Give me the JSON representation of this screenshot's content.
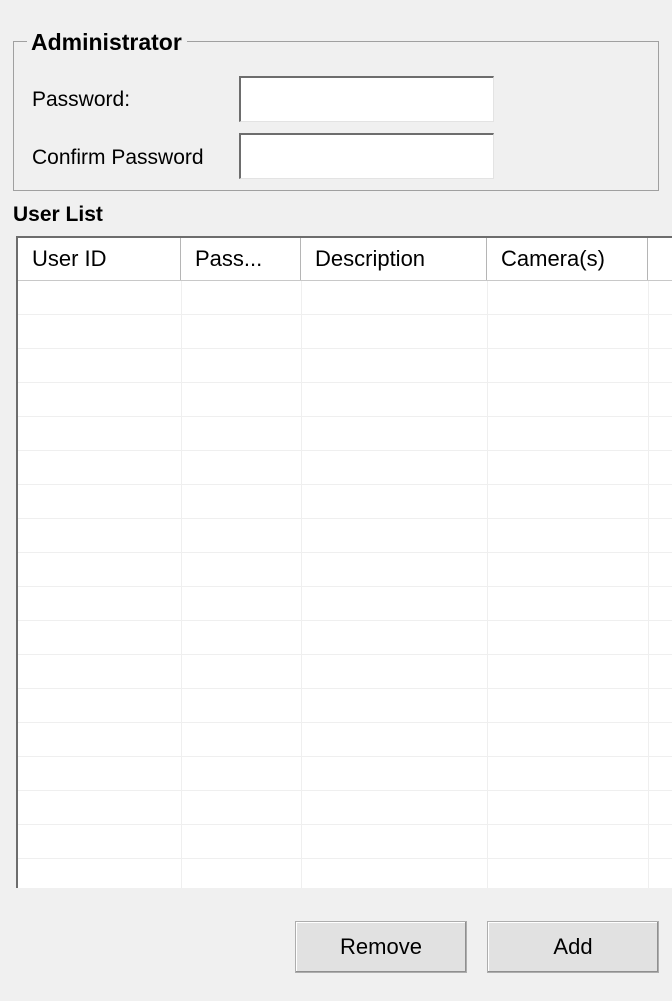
{
  "administrator": {
    "group_title": "Administrator",
    "password_label": "Password:",
    "password_value": "",
    "confirm_label": "Confirm Password",
    "confirm_value": ""
  },
  "user_list": {
    "title": "User List",
    "columns": [
      {
        "label": "User ID"
      },
      {
        "label": "Pass..."
      },
      {
        "label": "Description"
      },
      {
        "label": "Camera(s)"
      }
    ],
    "rows": []
  },
  "buttons": {
    "remove_label": "Remove",
    "add_label": "Add"
  }
}
